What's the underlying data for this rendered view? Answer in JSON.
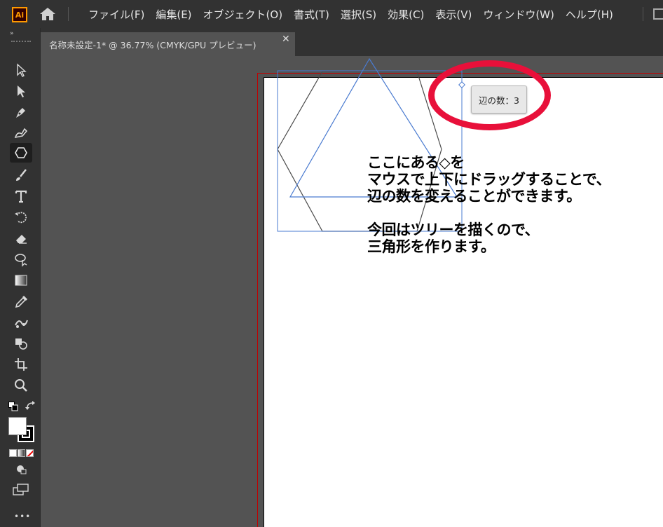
{
  "app": {
    "logo_text": "Ai",
    "accent": "#ff9a00",
    "logo_bg": "#330000"
  },
  "menu": {
    "items": [
      "ファイル(F)",
      "編集(E)",
      "オブジェクト(O)",
      "書式(T)",
      "選択(S)",
      "効果(C)",
      "表示(V)",
      "ウィンドウ(W)",
      "ヘルプ(H)"
    ]
  },
  "document_tab": {
    "title": "名称未設定-1* @ 36.77% (CMYK/GPU プレビュー)",
    "close_glyph": "✕"
  },
  "toolbar": {
    "collapse_glyph": "»",
    "tools": [
      {
        "name": "selection-tool-icon"
      },
      {
        "name": "direct-selection-tool-icon"
      },
      {
        "name": "pen-tool-icon"
      },
      {
        "name": "curvature-tool-icon"
      },
      {
        "name": "polygon-tool-icon",
        "active": true
      },
      {
        "name": "paintbrush-tool-icon"
      },
      {
        "name": "type-tool-icon"
      },
      {
        "name": "rotate-tool-icon"
      },
      {
        "name": "eraser-tool-icon"
      },
      {
        "name": "lasso-tool-icon"
      },
      {
        "name": "gradient-tool-icon"
      },
      {
        "name": "eyedropper-tool-icon"
      },
      {
        "name": "puppet-warp-tool-icon"
      },
      {
        "name": "shape-builder-tool-icon"
      },
      {
        "name": "artboard-tool-icon"
      },
      {
        "name": "zoom-tool-icon"
      }
    ],
    "more_glyph": "•••"
  },
  "canvas": {
    "tooltip": "辺の数：3",
    "callout_color": "#e8103a",
    "notes": {
      "note1_line1": "ここにある◇を",
      "note1_line2": "マウスで上下にドラッグすることで、",
      "note1_line3": "辺の数を変えることができます。",
      "note2_line1": "今回はツリーを描くので、",
      "note2_line2": "三角形を作ります。"
    }
  }
}
